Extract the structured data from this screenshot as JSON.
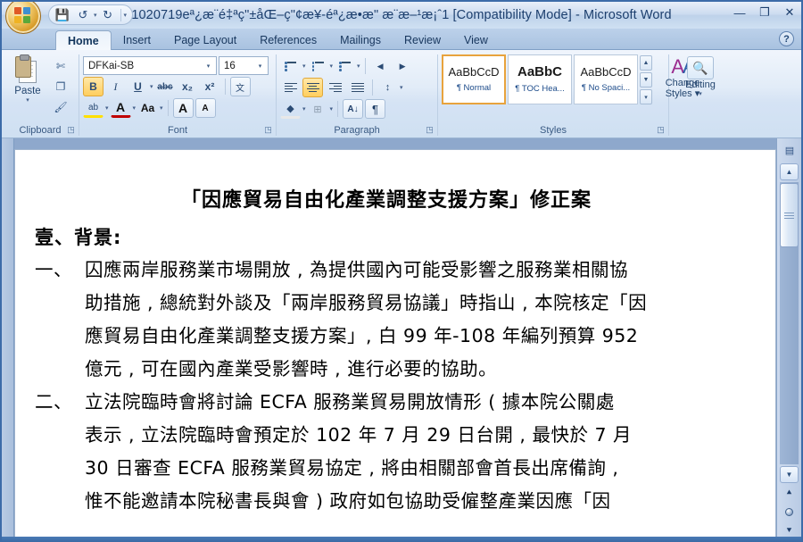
{
  "window": {
    "title": "1020719eª¿æ¨é‡ªç\"±åŒ–ç\"¢æ¥-éª¿æ•æ\" æ¨æ–¹æ¡ˆ1 [Compatibility Mode] - Microsoft Word",
    "minimize_label": "—",
    "restore_label": "❐",
    "close_label": "✕",
    "orb_name": "office-button"
  },
  "quick_access": {
    "save_label": "💾",
    "undo_label": "↺",
    "redo_label": "↻",
    "customize_label": "▾"
  },
  "tabs": [
    {
      "label": "Home",
      "active": true
    },
    {
      "label": "Insert",
      "active": false
    },
    {
      "label": "Page Layout",
      "active": false
    },
    {
      "label": "References",
      "active": false
    },
    {
      "label": "Mailings",
      "active": false
    },
    {
      "label": "Review",
      "active": false
    },
    {
      "label": "View",
      "active": false
    }
  ],
  "help_label": "?",
  "ribbon": {
    "clipboard": {
      "caption": "Clipboard",
      "paste_label": "Paste",
      "paste_caret": "▾",
      "cut_label": "✄",
      "copy_label": "❐",
      "format_painter_label": "🖌",
      "dialog_launcher": "◳"
    },
    "font": {
      "caption": "Font",
      "font_name": "DFKai-SB",
      "font_size": "16",
      "dropdown_caret": "▾",
      "bold_label": "B",
      "italic_label": "I",
      "underline_label": "U",
      "strike_label": "abc",
      "subscript_label": "x₂",
      "superscript_label": "x²",
      "phonetic_label": "文",
      "highlight_label": "ab",
      "fontcolor_label": "A",
      "changecase_label": "Aa",
      "grow_label": "A",
      "shrink_label": "A",
      "dialog_launcher": "◳",
      "bold_active": true
    },
    "paragraph": {
      "caption": "Paragraph",
      "bullets_label": "bullet-list",
      "numbering_label": "numbered-list",
      "multilevel_label": "multilevel-list",
      "decrease_indent_label": "◀",
      "increase_indent_label": "▶",
      "align_left_label": "align-left",
      "align_center_label": "align-center",
      "align_right_label": "align-right",
      "justify_label": "justify",
      "line_spacing_label": "↕",
      "shading_label": "shade",
      "borders_label": "borders",
      "sort_label": "A\nZ↓",
      "show_marks_label": "¶",
      "dialog_launcher": "◳",
      "align_center_active": true
    },
    "styles": {
      "caption": "Styles",
      "gallery": [
        {
          "preview": "AaBbCcD",
          "name": "¶ Normal",
          "bold": false,
          "selected": true
        },
        {
          "preview": "AaBbC",
          "name": "¶ TOC Hea...",
          "bold": true,
          "selected": false
        },
        {
          "preview": "AaBbCcD",
          "name": "¶ No Spaci...",
          "bold": false,
          "selected": false
        }
      ],
      "scroll_up": "▲",
      "scroll_down": "▼",
      "more": "▾",
      "change_styles_line1": "Change",
      "change_styles_line2": "Styles ▾",
      "dialog_launcher": "◳"
    },
    "editing": {
      "caption": "",
      "label": "Editing",
      "caret": "▾",
      "icon": "🔍"
    }
  },
  "document": {
    "title": "「因應貿易自由化產業調整支援方案」修正案",
    "heading": "壹、背景:",
    "paragraphs": [
      {
        "marker": "一、",
        "lines": [
          "囚應兩岸服務業市場開放 , 為提供國內可能受影響之服務業相關協",
          "助措施 , 總統對外談及「兩岸服務貿易協議」時指山 , 本院核定「因",
          "應貿易自由化產業調整支援方案」, 白 99 年-108 年編列預算 952",
          "億元 , 可在國內產業受影響時 , 進行必要的協助。"
        ]
      },
      {
        "marker": "二、",
        "lines": [
          "立法院臨時會將討論 ECFA 服務業貿易開放情形 ( 據本院公關處",
          "表示 , 立法院臨時會預定於 102 年 7 月 29 日台開 , 最快於 7 月",
          "30 日審查 ECFA 服務業貿易協定 , 將由相關部會首長出席備詢 ,",
          "惟不能邀請本院秘書長與會 ) 政府如包協助受僱整產業因應「因"
        ]
      }
    ]
  },
  "scrollbar": {
    "split_label": "▤",
    "up_label": "▲",
    "down_label": "▼",
    "prev_page_label": "⯅",
    "select_object_label": "select-browse-object",
    "next_page_label": "⯆"
  }
}
